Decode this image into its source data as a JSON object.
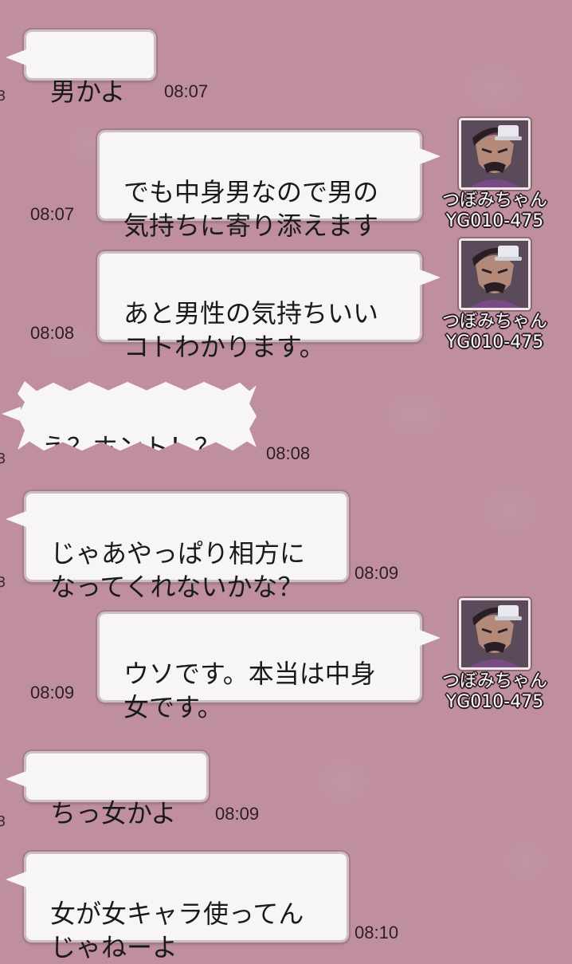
{
  "avatar_icon": "character-portrait-icon",
  "user": {
    "name": "つぼみちゃん",
    "id": "YG010-475"
  },
  "messages": [
    {
      "side": "left",
      "text": "男かよ",
      "time": "08:07"
    },
    {
      "side": "right",
      "text": "でも中身男なので男の\n気持ちに寄り添えます",
      "time": "08:07"
    },
    {
      "side": "right",
      "text": "あと男性の気持ちいい\nコトわかります。",
      "time": "08:08"
    },
    {
      "side": "left",
      "text": "え？ホント！？",
      "time": "08:08",
      "style": "shout"
    },
    {
      "side": "left",
      "text": "じゃあやっぱり相方に\nなってくれないかな？",
      "time": "08:09"
    },
    {
      "side": "right",
      "text": "ウソです。本当は中身\n女です。",
      "time": "08:09"
    },
    {
      "side": "left",
      "text": "ちっ女かよ",
      "time": "08:09"
    },
    {
      "side": "left",
      "text": "女が女キャラ使ってん\nじゃねーよ",
      "time": "08:10"
    }
  ]
}
